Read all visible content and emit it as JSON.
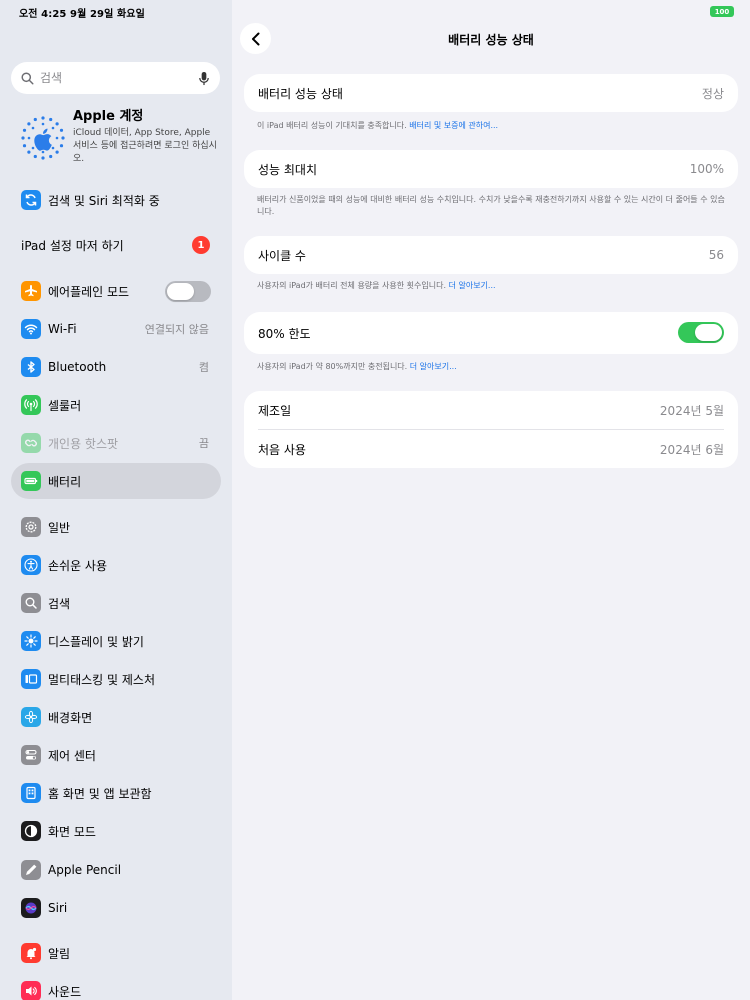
{
  "status": {
    "time_date": "오전 4:25   9월 29일 화요일",
    "battery": "100"
  },
  "search": {
    "placeholder": "검색"
  },
  "account": {
    "name": "Apple 계정",
    "description": "iCloud 데이터, App Store, Apple 서비스 등에 접근하려면 로그인 하십시오."
  },
  "sidebar": {
    "siri_search": "검색 및 Siri 최적화 중",
    "setup": {
      "label": "iPad 설정 마저 하기",
      "badge": "1"
    },
    "airplane": {
      "label": "에어플레인 모드",
      "on": false
    },
    "wifi": {
      "label": "Wi-Fi",
      "value": "연결되지 않음"
    },
    "bluetooth": {
      "label": "Bluetooth",
      "value": "켬"
    },
    "cellular": {
      "label": "셀룰러"
    },
    "hotspot": {
      "label": "개인용 핫스팟",
      "value": "끔"
    },
    "battery": {
      "label": "배터리"
    },
    "general": {
      "label": "일반"
    },
    "accessibility": {
      "label": "손쉬운 사용"
    },
    "search": {
      "label": "검색"
    },
    "display": {
      "label": "디스플레이 및 밝기"
    },
    "multitasking": {
      "label": "멀티태스킹 및 제스처"
    },
    "wallpaper": {
      "label": "배경화면"
    },
    "control_center": {
      "label": "제어 센터"
    },
    "home_screen": {
      "label": "홈 화면 및 앱 보관함"
    },
    "screen_mode": {
      "label": "화면 모드"
    },
    "pencil": {
      "label": "Apple Pencil"
    },
    "siri": {
      "label": "Siri"
    },
    "notifications": {
      "label": "알림"
    },
    "sounds": {
      "label": "사운드"
    }
  },
  "detail": {
    "title": "배터리 성능 상태",
    "health": {
      "label": "배터리 성능 상태",
      "value": "정상"
    },
    "health_note": "이 iPad 배터리 성능이 기대치를 충족합니다.",
    "health_link": "배터리 및 보증에 관하여...",
    "max_capacity": {
      "label": "성능 최대치",
      "value": "100%"
    },
    "max_capacity_note": "배터리가 신품이었을 때의 성능에 대비한 배터리 성능 수치입니다. 수치가 낮을수록 재충전하기까지 사용할 수 있는 시간이 더 줄어들 수 있습니다.",
    "cycle_count": {
      "label": "사이클 수",
      "value": "56"
    },
    "cycle_note": "사용자의 iPad가 배터리 전체 용량을 사용한 횟수입니다.",
    "cycle_link": "더 알아보기...",
    "limit": {
      "label": "80% 한도",
      "on": true
    },
    "limit_note": "사용자의 iPad가 약 80%까지만 충전됩니다.",
    "limit_link": "더 알아보기...",
    "manufacture": {
      "label": "제조일",
      "value": "2024년 5월"
    },
    "first_use": {
      "label": "처음 사용",
      "value": "2024년 6월"
    }
  },
  "colors": {
    "accent_blue": "#1a73e8",
    "toggle_on": "#34c759",
    "badge_red": "#ff3b30",
    "sidebar_bg": "#e6e9f0"
  }
}
